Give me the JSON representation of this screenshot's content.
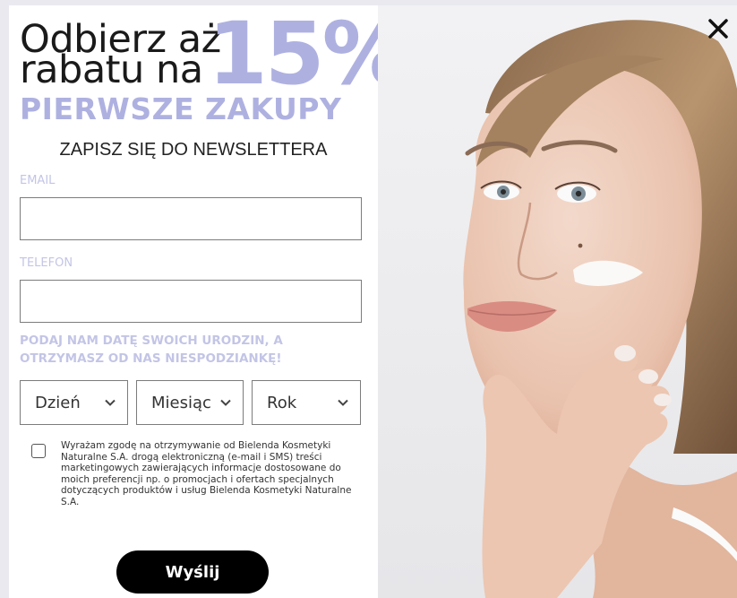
{
  "promo": {
    "headline_line1": "Odbierz aż",
    "headline_line2": "rabatu na",
    "discount": "15%",
    "subheadline": "PIERWSZE ZAKUPY",
    "title": "ZAPISZ SIĘ DO NEWSLETTERA"
  },
  "form": {
    "email_label": "EMAIL",
    "email_value": "",
    "phone_label": "TELEFON",
    "phone_value": "",
    "birthday_label": "PODAJ NAM DATĘ SWOICH URODZIN, A OTRZYMASZ OD NAS NIESPODZIANKĘ!",
    "day_select": "Dzień",
    "month_select": "Miesiąc",
    "year_select": "Rok",
    "consent_text": "Wyrażam zgodę na otrzymywanie od Bielenda Kosmetyki Naturalne S.A. drogą elektroniczną (e-mail i SMS) treści marketingowych zawierających informacje dostosowane do moich preferencji np. o promocjach i ofertach specjalnych dotyczących produktów i usług Bielenda Kosmetyki Naturalne S.A.",
    "consent_checked": false,
    "submit_label": "Wyślij"
  },
  "icons": {
    "close": "close-icon",
    "chevron": "chevron-down-icon"
  },
  "colors": {
    "accent": "#aeb1e0",
    "label": "#c3c5e6",
    "button": "#000000"
  }
}
